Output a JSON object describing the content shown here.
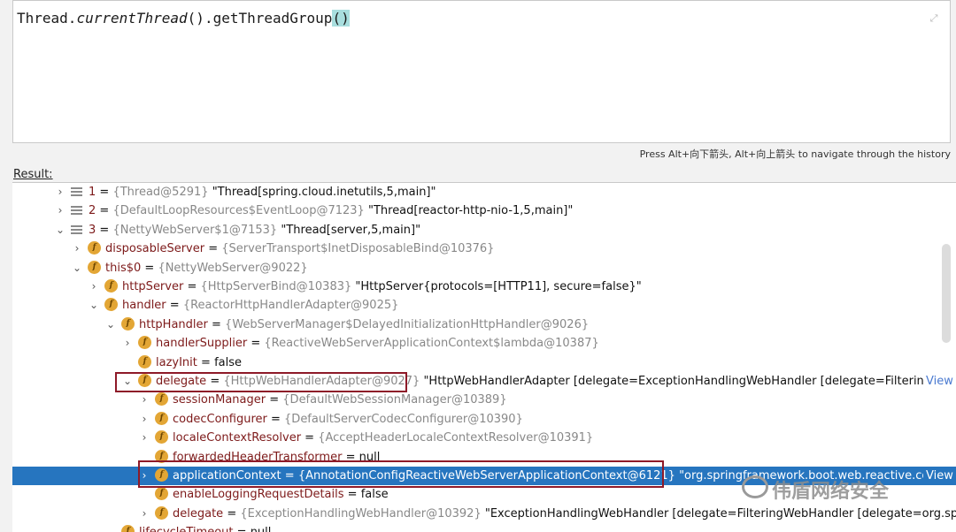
{
  "editor": {
    "code_prefix": "Thread.",
    "code_italic": "currentThread",
    "code_middle": "().getThreadGroup",
    "code_paren": "()"
  },
  "hint": "Press Alt+向下箭头, Alt+向上箭头 to navigate through the history",
  "result_label": "Result:",
  "rows": [
    {
      "name": "1",
      "type": "{Thread@5291}",
      "value": "\"Thread[spring.cloud.inetutils,5,main]\""
    },
    {
      "name": "2",
      "type": "{DefaultLoopResources$EventLoop@7123}",
      "value": "\"Thread[reactor-http-nio-1,5,main]\""
    },
    {
      "name": "3",
      "type": "{NettyWebServer$1@7153}",
      "value": "\"Thread[server,5,main]\""
    },
    {
      "name": "disposableServer",
      "type": "{ServerTransport$InetDisposableBind@10376}",
      "value": ""
    },
    {
      "name": "this$0",
      "type": "{NettyWebServer@9022}",
      "value": ""
    },
    {
      "name": "httpServer",
      "type": "{HttpServerBind@10383}",
      "value": "\"HttpServer{protocols=[HTTP11], secure=false}\""
    },
    {
      "name": "handler",
      "type": "{ReactorHttpHandlerAdapter@9025}",
      "value": ""
    },
    {
      "name": "httpHandler",
      "type": "{WebServerManager$DelayedInitializationHttpHandler@9026}",
      "value": ""
    },
    {
      "name": "handlerSupplier",
      "type": "{ReactiveWebServerApplicationContext$lambda@10387}",
      "value": ""
    },
    {
      "name": "lazyInit",
      "type": "",
      "value": "false"
    },
    {
      "name": "delegate",
      "type": "{HttpWebHandlerAdapter@9027}",
      "value": "\"HttpWebHandlerAdapter [delegate=ExceptionHandlingWebHandler [delegate=FilteringW..."
    },
    {
      "name": "sessionManager",
      "type": "{DefaultWebSessionManager@10389}",
      "value": ""
    },
    {
      "name": "codecConfigurer",
      "type": "{DefaultServerCodecConfigurer@10390}",
      "value": ""
    },
    {
      "name": "localeContextResolver",
      "type": "{AcceptHeaderLocaleContextResolver@10391}",
      "value": ""
    },
    {
      "name": "forwardedHeaderTransformer",
      "type": "",
      "value": "null"
    },
    {
      "name": "applicationContext",
      "type": "{AnnotationConfigReactiveWebServerApplicationContext@6121}",
      "value": "\"org.springframework.boot.web.reactive.cont..."
    },
    {
      "name": "enableLoggingRequestDetails",
      "type": "",
      "value": "false"
    },
    {
      "name": "delegate",
      "type": "{ExceptionHandlingWebHandler@10392}",
      "value": "\"ExceptionHandlingWebHandler [delegate=FilteringWebHandler [delegate=org.springf"
    },
    {
      "name": "lifecycleTimeout",
      "type": "",
      "value": "null"
    }
  ],
  "view_link": "View",
  "watermark": "伟盾网络安全"
}
